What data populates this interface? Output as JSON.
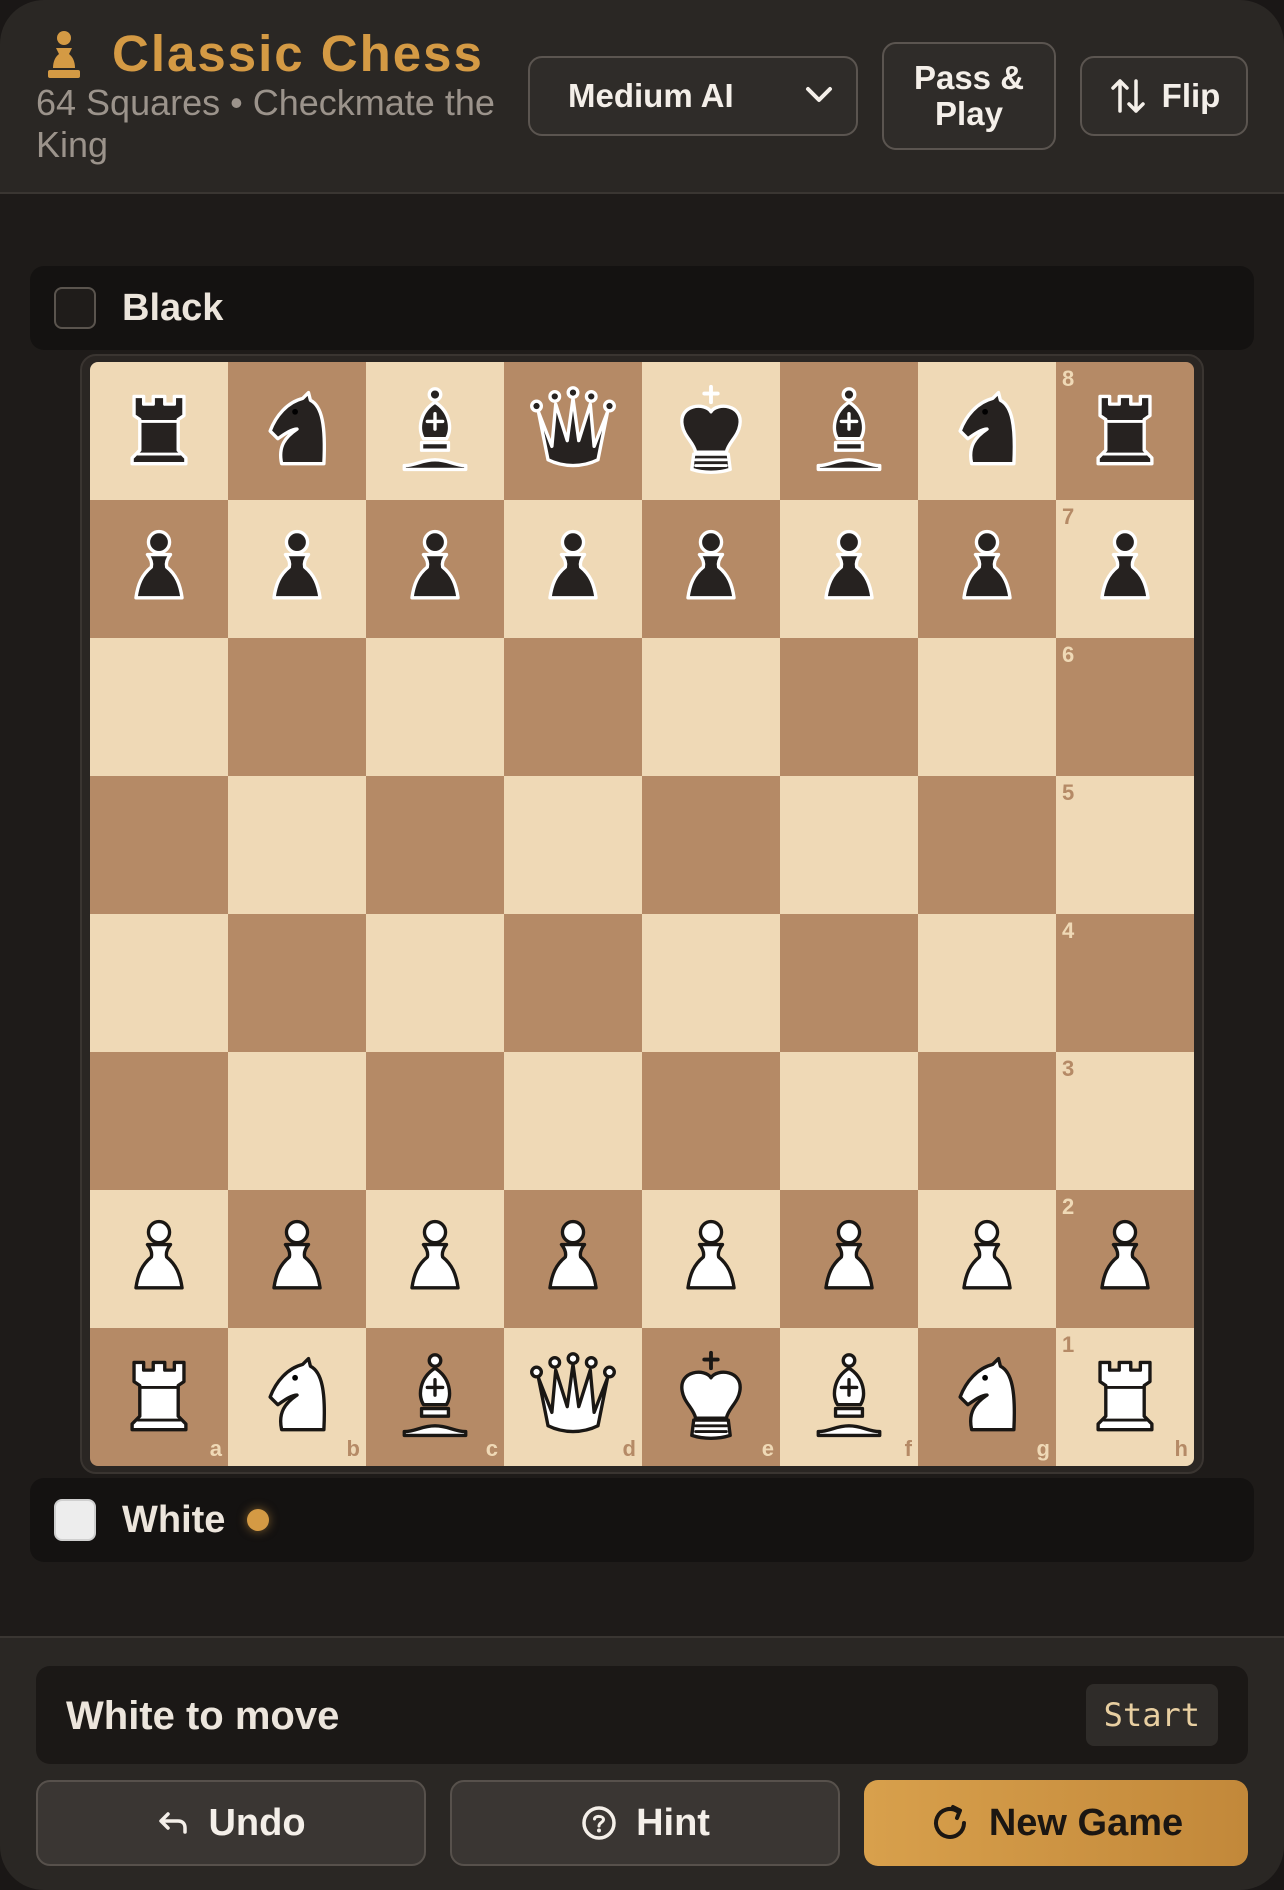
{
  "header": {
    "title": "Classic Chess",
    "subtitle": "64 Squares • Checkmate the King",
    "difficulty": {
      "selected": "Medium AI",
      "icon": "chevron-down-icon"
    },
    "pass_play_label": "Pass & Play",
    "flip_label": "Flip",
    "flip_icon": "swap-vertical-icon",
    "logo_icon": "pawn-icon",
    "accent_color": "#d49a44"
  },
  "players": {
    "black": {
      "name": "Black"
    },
    "white": {
      "name": "White",
      "active_turn": true
    }
  },
  "board": {
    "light_color": "#efd9b6",
    "dark_color": "#b58a66",
    "files": [
      "a",
      "b",
      "c",
      "d",
      "e",
      "f",
      "g",
      "h"
    ],
    "ranks": [
      "8",
      "7",
      "6",
      "5",
      "4",
      "3",
      "2",
      "1"
    ],
    "position": [
      [
        "br",
        "bn",
        "bb",
        "bq",
        "bk",
        "bb",
        "bn",
        "br"
      ],
      [
        "bp",
        "bp",
        "bp",
        "bp",
        "bp",
        "bp",
        "bp",
        "bp"
      ],
      [
        "",
        "",
        "",
        "",
        "",
        "",
        "",
        ""
      ],
      [
        "",
        "",
        "",
        "",
        "",
        "",
        "",
        ""
      ],
      [
        "",
        "",
        "",
        "",
        "",
        "",
        "",
        ""
      ],
      [
        "",
        "",
        "",
        "",
        "",
        "",
        "",
        ""
      ],
      [
        "wp",
        "wp",
        "wp",
        "wp",
        "wp",
        "wp",
        "wp",
        "wp"
      ],
      [
        "wr",
        "wn",
        "wb",
        "wq",
        "wk",
        "wb",
        "wn",
        "wr"
      ]
    ]
  },
  "status": {
    "text": "White to move",
    "badge": "Start"
  },
  "actions": {
    "undo_label": "Undo",
    "hint_label": "Hint",
    "new_game_label": "New Game"
  }
}
